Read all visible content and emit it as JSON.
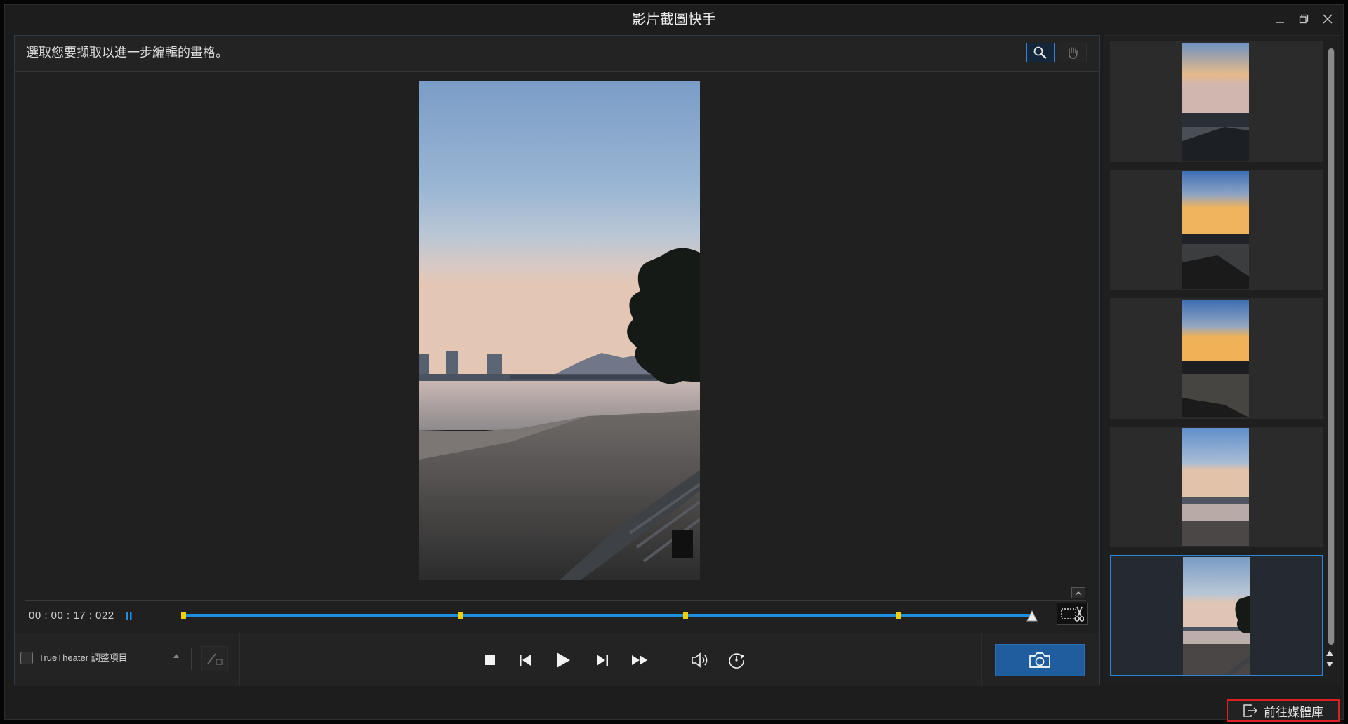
{
  "window": {
    "title": "影片截圖快手",
    "controls": [
      "minimize-icon",
      "restore-icon",
      "close-icon"
    ]
  },
  "toolbar": {
    "instruction": "選取您要擷取以進一步編輯的畫格。",
    "tools": [
      "magnifier-icon",
      "hand-icon"
    ],
    "active_tool": "magnifier-icon"
  },
  "timeline": {
    "timecode": "00 : 00 : 17 : 022",
    "markers": [
      0,
      0.325,
      0.59,
      0.84
    ],
    "playhead": 0.995
  },
  "controls": {
    "truetheater_label": "TrueTheater 調整項目",
    "truetheater_checked": false,
    "buttons": [
      "stop-icon",
      "previous-frame-icon",
      "play-icon",
      "next-frame-icon",
      "fast-forward-icon",
      "volume-icon",
      "speed-icon"
    ],
    "snapshot_icon": "camera-icon"
  },
  "thumbnails": {
    "count": 5,
    "selected_index": 4
  },
  "footer": {
    "goto_library_label": "前往媒體庫"
  },
  "colors": {
    "accent": "#1e8fe0",
    "marker": "#f3d000",
    "snapshot_button": "#1f5d9f",
    "highlight_box": "#e02020"
  }
}
